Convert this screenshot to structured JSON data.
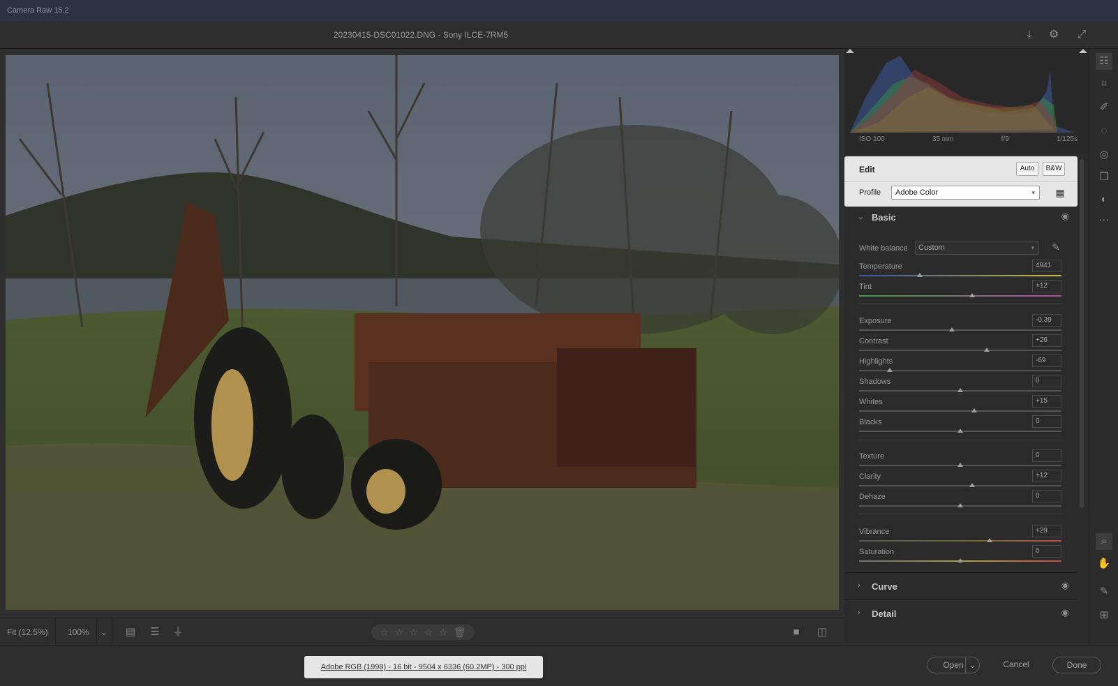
{
  "app": {
    "title": "Camera Raw 15.2"
  },
  "header": {
    "file_title": "20230415-DSC01022.DNG  -  Sony ILCE-7RM5",
    "icons": [
      "save-icon",
      "gear-icon",
      "fullscreen-icon"
    ]
  },
  "bottom_bar": {
    "zoom_fit": "Fit (12.5%)",
    "zoom_100": "100%",
    "rating_stars": 5
  },
  "footer": {
    "image_info": "Adobe RGB (1998) - 16 bit - 9504 x 6336 (60.2MP) - 300 ppi",
    "open_label": "Open",
    "cancel_label": "Cancel",
    "done_label": "Done"
  },
  "histogram": {
    "iso": "ISO 100",
    "focal": "35 mm",
    "aperture": "f/9",
    "shutter": "1/125s"
  },
  "edit": {
    "title": "Edit",
    "auto_label": "Auto",
    "bw_label": "B&W",
    "profile_label": "Profile",
    "profile_value": "Adobe Color"
  },
  "basic": {
    "title": "Basic",
    "wb_label": "White balance",
    "wb_value": "Custom",
    "sliders": [
      {
        "label": "Temperature",
        "value": "4941",
        "pos": 0.3
      },
      {
        "label": "Tint",
        "value": "+12",
        "pos": 0.56
      },
      {
        "label": "Exposure",
        "value": "-0.39",
        "pos": 0.46
      },
      {
        "label": "Contrast",
        "value": "+26",
        "pos": 0.63
      },
      {
        "label": "Highlights",
        "value": "-69",
        "pos": 0.15
      },
      {
        "label": "Shadows",
        "value": "0",
        "pos": 0.5
      },
      {
        "label": "Whites",
        "value": "+15",
        "pos": 0.57
      },
      {
        "label": "Blacks",
        "value": "0",
        "pos": 0.5
      },
      {
        "label": "Texture",
        "value": "0",
        "pos": 0.5
      },
      {
        "label": "Clarity",
        "value": "+12",
        "pos": 0.56
      },
      {
        "label": "Dehaze",
        "value": "0",
        "pos": 0.5
      },
      {
        "label": "Vibrance",
        "value": "+29",
        "pos": 0.645
      },
      {
        "label": "Saturation",
        "value": "0",
        "pos": 0.5
      }
    ]
  },
  "sections": {
    "curve": "Curve",
    "detail": "Detail"
  }
}
